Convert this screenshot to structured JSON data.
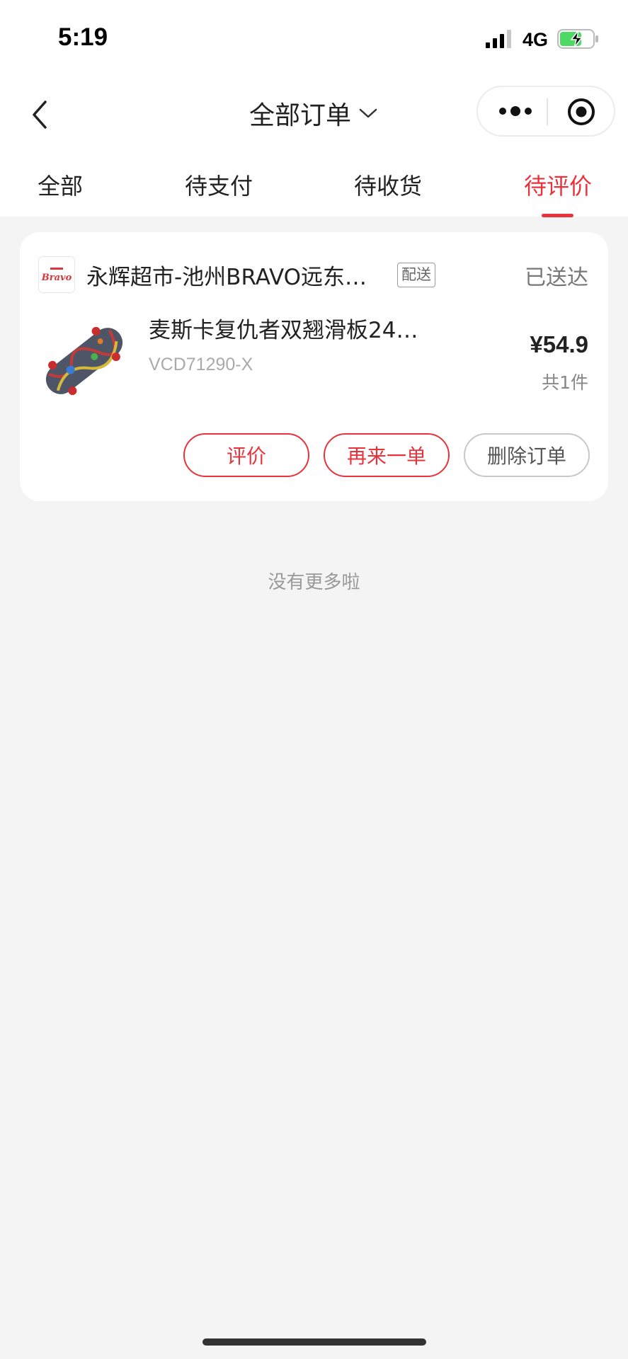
{
  "status_bar": {
    "time": "5:19",
    "network": "4G",
    "icons": [
      "signal-icon",
      "battery-charging-icon"
    ]
  },
  "nav": {
    "title": "全部订单",
    "icons": [
      "back-icon",
      "chevron-down-icon",
      "more-icon",
      "target-icon"
    ]
  },
  "tabs": [
    {
      "label": "全部",
      "active": false
    },
    {
      "label": "待支付",
      "active": false
    },
    {
      "label": "待收货",
      "active": false
    },
    {
      "label": "待评价",
      "active": true
    }
  ],
  "order": {
    "store_logo_text": "Bravo",
    "store_name": "永辉超市-池州BRAVO远东…",
    "delivery_tag": "配送",
    "status": "已送达",
    "product": {
      "name": "麦斯卡复仇者双翘滑板24…",
      "sku": "VCD71290-X",
      "price": "¥54.9",
      "count": "共1件"
    },
    "actions": [
      {
        "label": "评价",
        "style": "red"
      },
      {
        "label": "再来一单",
        "style": "red"
      },
      {
        "label": "删除订单",
        "style": "gray"
      }
    ]
  },
  "footer": {
    "no_more_text": "没有更多啦"
  },
  "colors": {
    "accent": "#e8323c",
    "background": "#f4f4f4",
    "card": "#ffffff"
  }
}
